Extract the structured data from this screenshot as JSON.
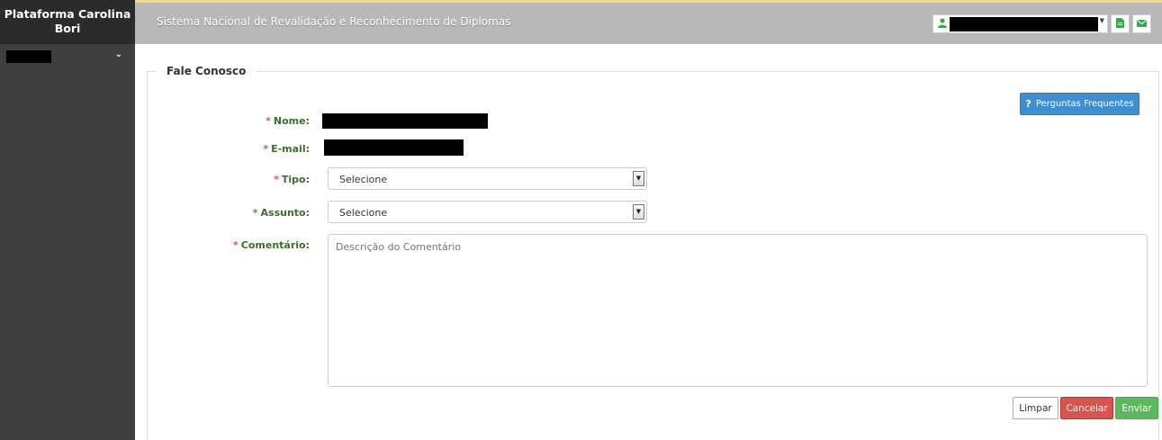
{
  "sidebar": {
    "brand": "Plataforma Carolina Bori",
    "user_menu_chevron": "⌄"
  },
  "header": {
    "title": "Sistema Nacional de Revalidação e Reconhecimento de Diplomas",
    "icons": [
      "user-icon",
      "document-icon",
      "envelope-icon"
    ]
  },
  "form": {
    "legend": "Fale Conosco",
    "faq_button": "Perguntas Frequentes",
    "faq_icon": "?",
    "required_mark": "*",
    "fields": {
      "nome_label": "Nome:",
      "email_label": "E-mail:",
      "tipo_label": "Tipo:",
      "tipo_value": "Selecione",
      "assunto_label": "Assunto:",
      "assunto_value": "Selecione",
      "comentario_label": "Comentário:",
      "comentario_placeholder": "Descrição do Comentário"
    },
    "buttons": {
      "limpar": "Limpar",
      "cancelar": "Cancelar",
      "enviar": "Enviar"
    }
  },
  "colors": {
    "sidebar": "#3f3f3f",
    "header": "#b8b8b8",
    "label_green": "#3a6f2a",
    "primary_blue": "#3d8fd1",
    "danger_red": "#d9534f",
    "success_green": "#5cb85c"
  }
}
